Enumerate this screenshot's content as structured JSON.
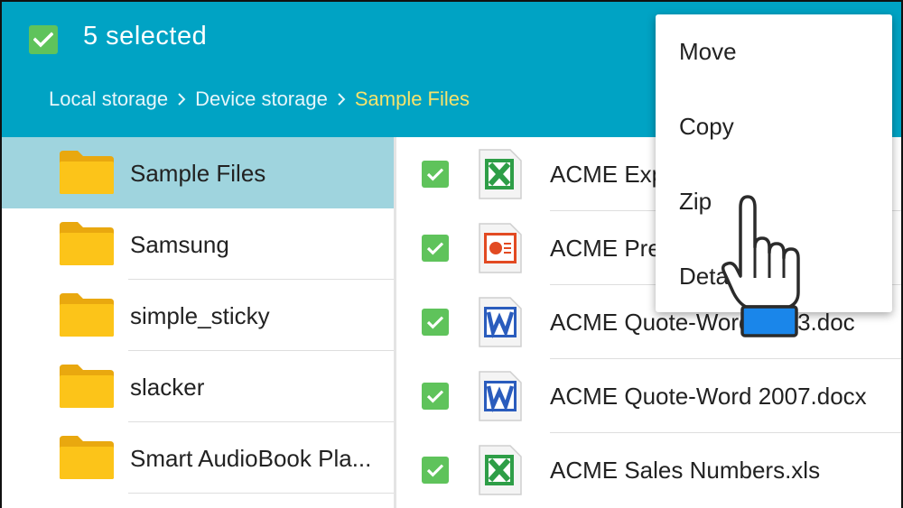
{
  "header": {
    "selected_count": "5 selected",
    "breadcrumb": [
      "Local storage",
      "Device storage",
      "Sample Files"
    ],
    "bg_color": "#00a3c4",
    "current_crumb_color": "#f7e36c"
  },
  "folders": [
    {
      "name": "Sample Files",
      "active": true
    },
    {
      "name": "Samsung",
      "active": false
    },
    {
      "name": "simple_sticky",
      "active": false
    },
    {
      "name": "slacker",
      "active": false
    },
    {
      "name": "Smart AudioBook Pla...",
      "active": false
    }
  ],
  "files": [
    {
      "name": "ACME Expenses.xlsx",
      "icon": "excel-icon",
      "checked": true
    },
    {
      "name": "ACME Presentation.pptx",
      "icon": "powerpoint-icon",
      "checked": true
    },
    {
      "name": "ACME Quote-Word 2003.doc",
      "icon": "word-icon",
      "checked": true
    },
    {
      "name": "ACME Quote-Word 2007.docx",
      "icon": "word-icon",
      "checked": true
    },
    {
      "name": "ACME Sales Numbers.xls",
      "icon": "excel-icon",
      "checked": true
    }
  ],
  "context_menu": {
    "items": [
      "Move",
      "Copy",
      "Zip",
      "Details"
    ]
  },
  "colors": {
    "checkbox": "#5fc35b",
    "folder": "#fcc419",
    "active_row": "#9fd4de",
    "excel": "#2e9e47",
    "powerpoint": "#e24a22",
    "word": "#2a5cbd"
  },
  "pointer": "hand-pointer-icon"
}
